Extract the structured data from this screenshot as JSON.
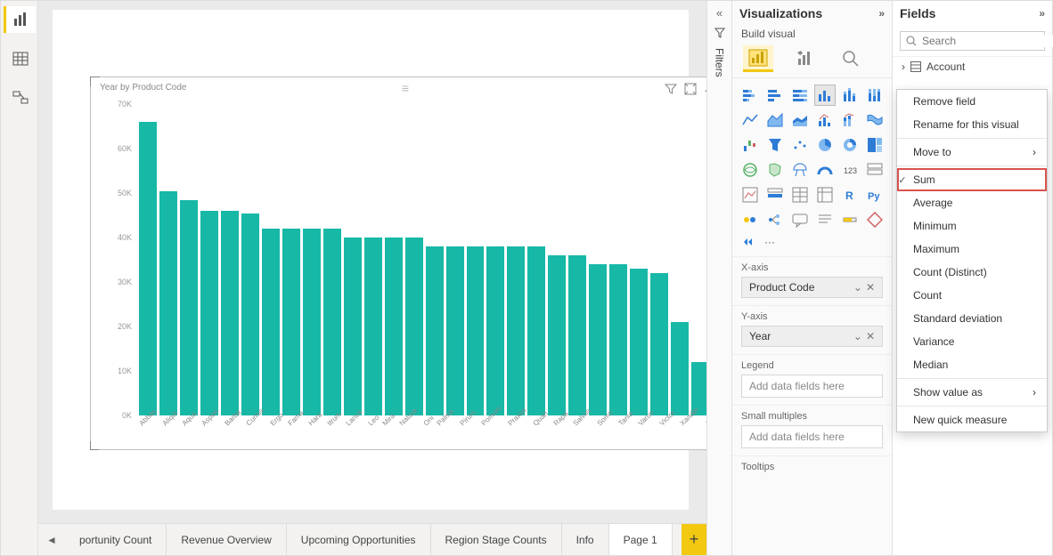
{
  "panes": {
    "visualizations": {
      "title": "Visualizations",
      "sub": "Build visual"
    },
    "fields": {
      "title": "Fields"
    },
    "filters": {
      "title": "Filters"
    }
  },
  "search": {
    "placeholder": "Search"
  },
  "field_tables": {
    "account": "Account"
  },
  "wells": {
    "x_axis": {
      "label": "X-axis",
      "value": "Product Code"
    },
    "y_axis": {
      "label": "Y-axis",
      "value": "Year"
    },
    "legend": {
      "label": "Legend",
      "placeholder": "Add data fields here"
    },
    "small_multiples": {
      "label": "Small multiples",
      "placeholder": "Add data fields here"
    },
    "tooltips": {
      "label": "Tooltips"
    }
  },
  "tabs": {
    "items": [
      "portunity Count",
      "Revenue Overview",
      "Upcoming Opportunities",
      "Region Stage Counts",
      "Info",
      "Page 1"
    ],
    "active_index": 5
  },
  "context_menu": {
    "remove": "Remove field",
    "rename": "Rename for this visual",
    "move_to": "Move to",
    "sum": "Sum",
    "average": "Average",
    "minimum": "Minimum",
    "maximum": "Maximum",
    "count_distinct": "Count (Distinct)",
    "count": "Count",
    "std_dev": "Standard deviation",
    "variance": "Variance",
    "median": "Median",
    "show_value_as": "Show value as",
    "new_quick_measure": "New quick measure"
  },
  "visual": {
    "title": "Year by Product Code",
    "more_label": "···"
  },
  "chart_data": {
    "type": "bar",
    "title": "Year by Product Code",
    "xlabel": "",
    "ylabel": "",
    "ylim": [
      0,
      70000
    ],
    "y_ticks": [
      "0K",
      "10K",
      "20K",
      "30K",
      "40K",
      "50K",
      "60K",
      "70K"
    ],
    "categories": [
      "Abbas",
      "Aliqui",
      "Aqua",
      "Aspen",
      "Barba",
      "Currus",
      "Ergo",
      "Fama",
      "Hara",
      "Itrum",
      "Lanus",
      "Leo",
      "Mira",
      "Natura",
      "Oni",
      "Palma",
      "Pirum",
      "Pomum",
      "Praxos",
      "Quari",
      "Rapa",
      "Salvus",
      "Somn",
      "Tania",
      "Varun",
      "Victor",
      "Xander",
      "Zera"
    ],
    "values": [
      66000,
      50500,
      48500,
      46000,
      46000,
      45500,
      42000,
      42000,
      42000,
      42000,
      40000,
      40000,
      40000,
      40000,
      38000,
      38000,
      38000,
      38000,
      38000,
      38000,
      36000,
      36000,
      34000,
      34000,
      33000,
      32000,
      21000,
      12000
    ]
  },
  "colors": {
    "bar": "#17b8a6",
    "accent": "#f2c811"
  }
}
